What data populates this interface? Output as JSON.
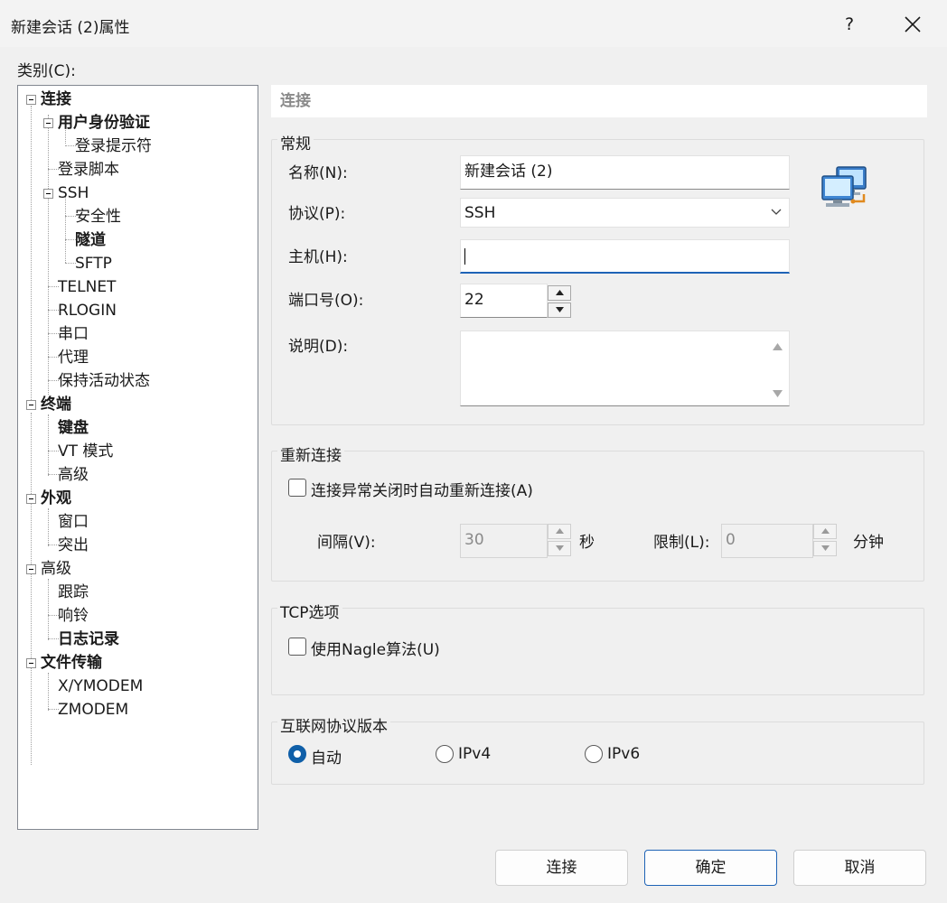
{
  "window": {
    "title": "新建会话 (2)属性",
    "help_glyph": "?"
  },
  "category": {
    "label": "类别(C):"
  },
  "tree": [
    {
      "label": "连接",
      "bold": true
    },
    {
      "label": "用户身份验证",
      "bold": true
    },
    {
      "label": "登录提示符",
      "bold": false
    },
    {
      "label": "登录脚本",
      "bold": false
    },
    {
      "label": "SSH",
      "bold": false
    },
    {
      "label": "安全性",
      "bold": false
    },
    {
      "label": "隧道",
      "bold": true
    },
    {
      "label": "SFTP",
      "bold": false
    },
    {
      "label": "TELNET",
      "bold": false
    },
    {
      "label": "RLOGIN",
      "bold": false
    },
    {
      "label": "串口",
      "bold": false
    },
    {
      "label": "代理",
      "bold": false
    },
    {
      "label": "保持活动状态",
      "bold": false
    },
    {
      "label": "终端",
      "bold": true
    },
    {
      "label": "键盘",
      "bold": true
    },
    {
      "label": "VT 模式",
      "bold": false
    },
    {
      "label": "高级",
      "bold": false
    },
    {
      "label": "外观",
      "bold": true
    },
    {
      "label": "窗口",
      "bold": false
    },
    {
      "label": "突出",
      "bold": false
    },
    {
      "label": "高级",
      "bold": false
    },
    {
      "label": "跟踪",
      "bold": false
    },
    {
      "label": "响铃",
      "bold": false
    },
    {
      "label": "日志记录",
      "bold": true
    },
    {
      "label": "文件传输",
      "bold": true
    },
    {
      "label": "X/YMODEM",
      "bold": false
    },
    {
      "label": "ZMODEM",
      "bold": false
    }
  ],
  "section": {
    "header": "连接"
  },
  "general": {
    "title": "常规",
    "name_label": "名称(N):",
    "name_value": "新建会话 (2)",
    "protocol_label": "协议(P):",
    "protocol_value": "SSH",
    "host_label": "主机(H):",
    "host_value": "",
    "port_label": "端口号(O):",
    "port_value": "22",
    "desc_label": "说明(D):",
    "desc_value": ""
  },
  "reconnect": {
    "title": "重新连接",
    "auto_label": "连接异常关闭时自动重新连接(A)",
    "auto_checked": false,
    "interval_label": "间隔(V):",
    "interval_value": "30",
    "interval_unit": "秒",
    "limit_label": "限制(L):",
    "limit_value": "0",
    "limit_unit": "分钟"
  },
  "tcp": {
    "title": "TCP选项",
    "nagle_label": "使用Nagle算法(U)",
    "nagle_checked": false
  },
  "ipver": {
    "title": "互联网协议版本",
    "options": [
      "自动",
      "IPv4",
      "IPv6"
    ],
    "selected": "自动"
  },
  "buttons": {
    "connect": "连接",
    "ok": "确定",
    "cancel": "取消"
  },
  "colors": {
    "accent": "#1e63b6",
    "radio_selected": "#0f5fa8",
    "background": "#f0f0f0"
  }
}
